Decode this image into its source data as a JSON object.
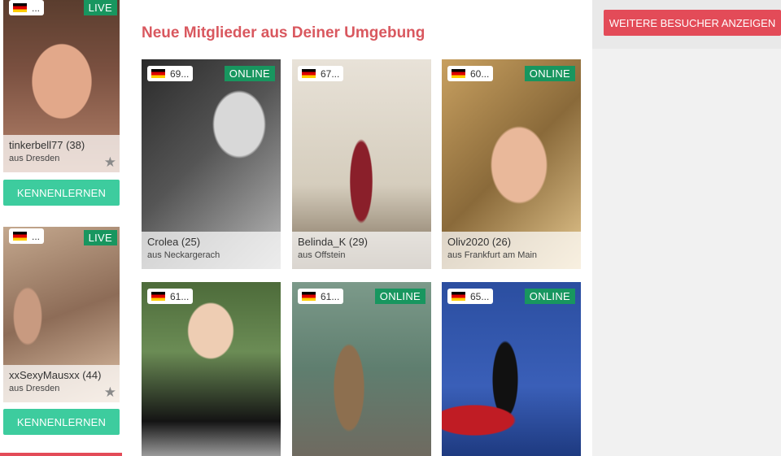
{
  "left_profiles": [
    {
      "flag": "de-flag-icon",
      "country_code": "...",
      "status": "LIVE",
      "name": "tinkerbell77 (38)",
      "city": "aus Dresden",
      "button_label": "KENNENLERNEN"
    },
    {
      "flag": "de-flag-icon",
      "country_code": "...",
      "status": "LIVE",
      "name": "xxSexyMausxx (44)",
      "city": "aus Dresden",
      "button_label": "KENNENLERNEN"
    }
  ],
  "main": {
    "section_title": "Neue Mitglieder aus Deiner Umgebung",
    "members": [
      {
        "flag": "de-flag-icon",
        "code": "69...",
        "status": "ONLINE",
        "name": "Crolea (25)",
        "city": "aus Neckargerach"
      },
      {
        "flag": "de-flag-icon",
        "code": "67...",
        "status": "",
        "name": "Belinda_K (29)",
        "city": "aus Offstein"
      },
      {
        "flag": "de-flag-icon",
        "code": "60...",
        "status": "ONLINE",
        "name": "Oliv2020 (26)",
        "city": "aus Frankfurt am Main"
      },
      {
        "flag": "de-flag-icon",
        "code": "61...",
        "status": "",
        "name": "",
        "city": ""
      },
      {
        "flag": "de-flag-icon",
        "code": "61...",
        "status": "ONLINE",
        "name": "",
        "city": ""
      },
      {
        "flag": "de-flag-icon",
        "code": "65...",
        "status": "ONLINE",
        "name": "",
        "city": ""
      }
    ]
  },
  "right": {
    "visitors_button": "WEITERE BESUCHER ANZEIGEN"
  },
  "colors": {
    "accent_red": "#e34b58",
    "accent_green": "#3dcc9e",
    "badge_green": "#18965f",
    "title_red": "#d9585f"
  }
}
